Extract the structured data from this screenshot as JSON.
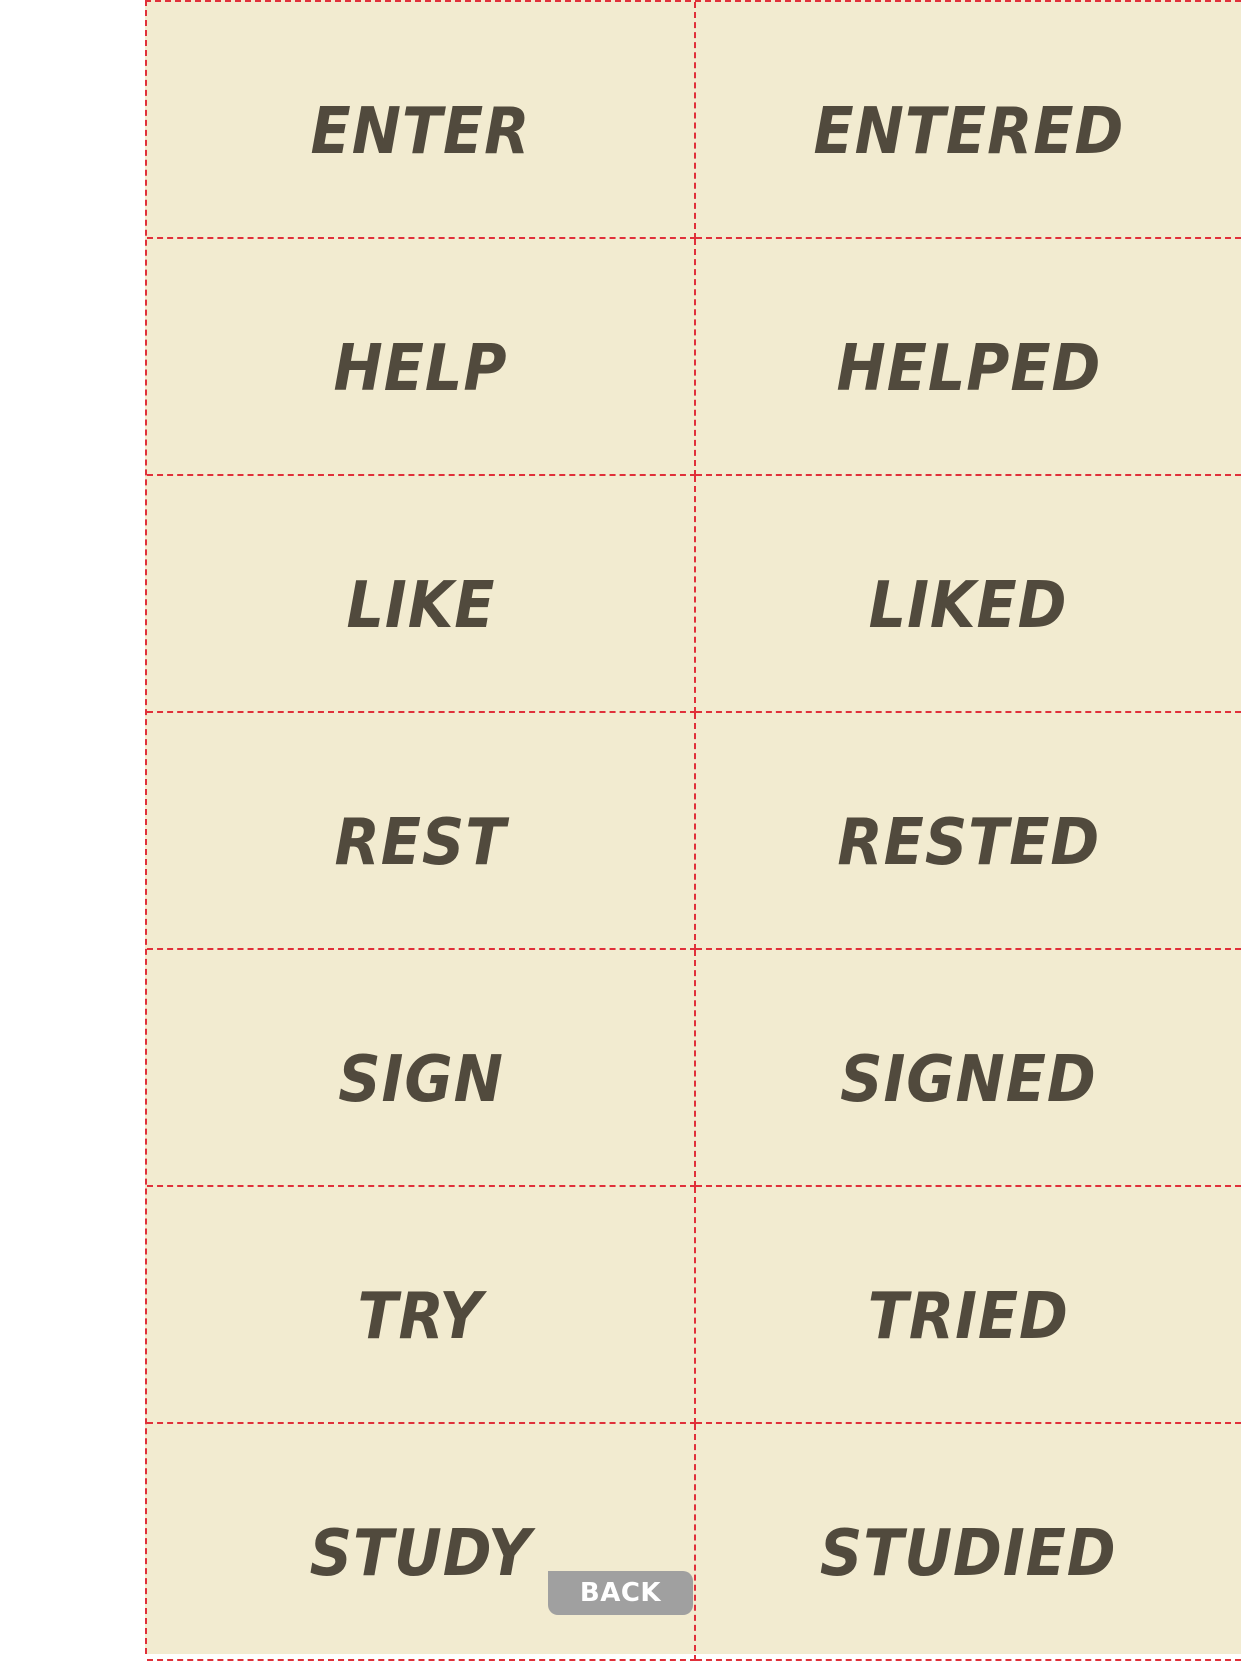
{
  "cards": [
    {
      "base": "ENTER",
      "past": "ENTERED"
    },
    {
      "base": "HELP",
      "past": "HELPED"
    },
    {
      "base": "LIKE",
      "past": "LIKED"
    },
    {
      "base": "REST",
      "past": "RESTED"
    },
    {
      "base": "SIGN",
      "past": "SIGNED"
    },
    {
      "base": "TRY",
      "past": "TRIED"
    },
    {
      "base": "STUDY",
      "past": "STUDIED"
    }
  ],
  "back_button": {
    "label": "BACK"
  },
  "colors": {
    "card_background": "#f2ebd0",
    "cut_line": "#e0303a",
    "word_text": "#514a3d",
    "back_button_bg": "#a0a0a0"
  }
}
